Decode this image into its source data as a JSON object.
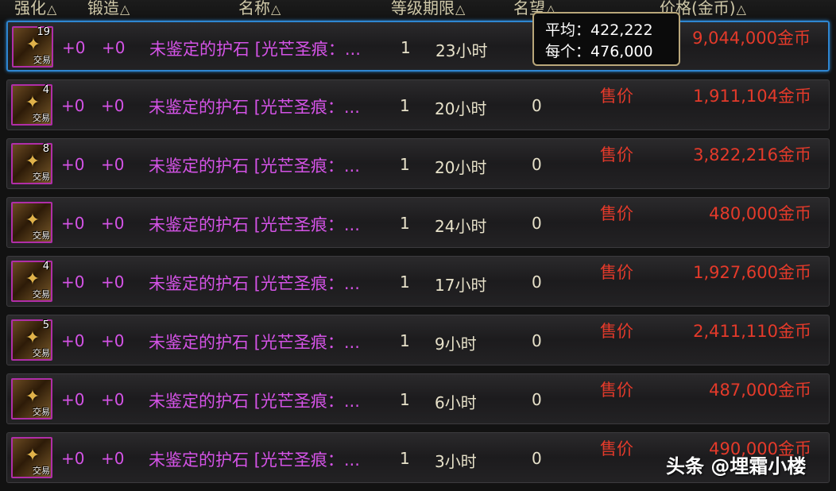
{
  "header": {
    "enhance": "强化",
    "forge": "锻造",
    "name": "名称",
    "level_duration": "等级期限",
    "fame": "名望",
    "price": "价格(金币)",
    "sort_icon": "△"
  },
  "rows": [
    {
      "count": "19",
      "trade": "交易",
      "enhance": "+0",
      "forge": "+0",
      "name": "未鉴定的护石 [光芒圣痕：...",
      "level": "1",
      "duration": "23小时",
      "fame": "",
      "sale_label": "",
      "price": "9,044,000金币",
      "selected": true
    },
    {
      "count": "4",
      "trade": "交易",
      "enhance": "+0",
      "forge": "+0",
      "name": "未鉴定的护石 [光芒圣痕：...",
      "level": "1",
      "duration": "20小时",
      "fame": "0",
      "sale_label": "售价",
      "price": "1,911,104金币"
    },
    {
      "count": "8",
      "trade": "交易",
      "enhance": "+0",
      "forge": "+0",
      "name": "未鉴定的护石 [光芒圣痕：...",
      "level": "1",
      "duration": "20小时",
      "fame": "0",
      "sale_label": "售价",
      "price": "3,822,216金币"
    },
    {
      "count": "",
      "trade": "交易",
      "enhance": "+0",
      "forge": "+0",
      "name": "未鉴定的护石 [光芒圣痕：...",
      "level": "1",
      "duration": "24小时",
      "fame": "0",
      "sale_label": "售价",
      "price": "480,000金币"
    },
    {
      "count": "4",
      "trade": "交易",
      "enhance": "+0",
      "forge": "+0",
      "name": "未鉴定的护石 [光芒圣痕：...",
      "level": "1",
      "duration": "17小时",
      "fame": "0",
      "sale_label": "售价",
      "price": "1,927,600金币"
    },
    {
      "count": "5",
      "trade": "交易",
      "enhance": "+0",
      "forge": "+0",
      "name": "未鉴定的护石 [光芒圣痕：...",
      "level": "1",
      "duration": "9小时",
      "fame": "0",
      "sale_label": "售价",
      "price": "2,411,110金币"
    },
    {
      "count": "",
      "trade": "交易",
      "enhance": "+0",
      "forge": "+0",
      "name": "未鉴定的护石 [光芒圣痕：...",
      "level": "1",
      "duration": "6小时",
      "fame": "0",
      "sale_label": "售价",
      "price": "487,000金币"
    },
    {
      "count": "",
      "trade": "交易",
      "enhance": "+0",
      "forge": "+0",
      "name": "未鉴定的护石 [光芒圣痕：...",
      "level": "1",
      "duration": "3小时",
      "fame": "0",
      "sale_label": "售价",
      "price": "490,000金币"
    }
  ],
  "tooltip": {
    "avg_label": "平均：",
    "avg_value": "422,222",
    "each_label": "每个：",
    "each_value": "476,000"
  },
  "watermark": "头条 @埋霜小楼"
}
